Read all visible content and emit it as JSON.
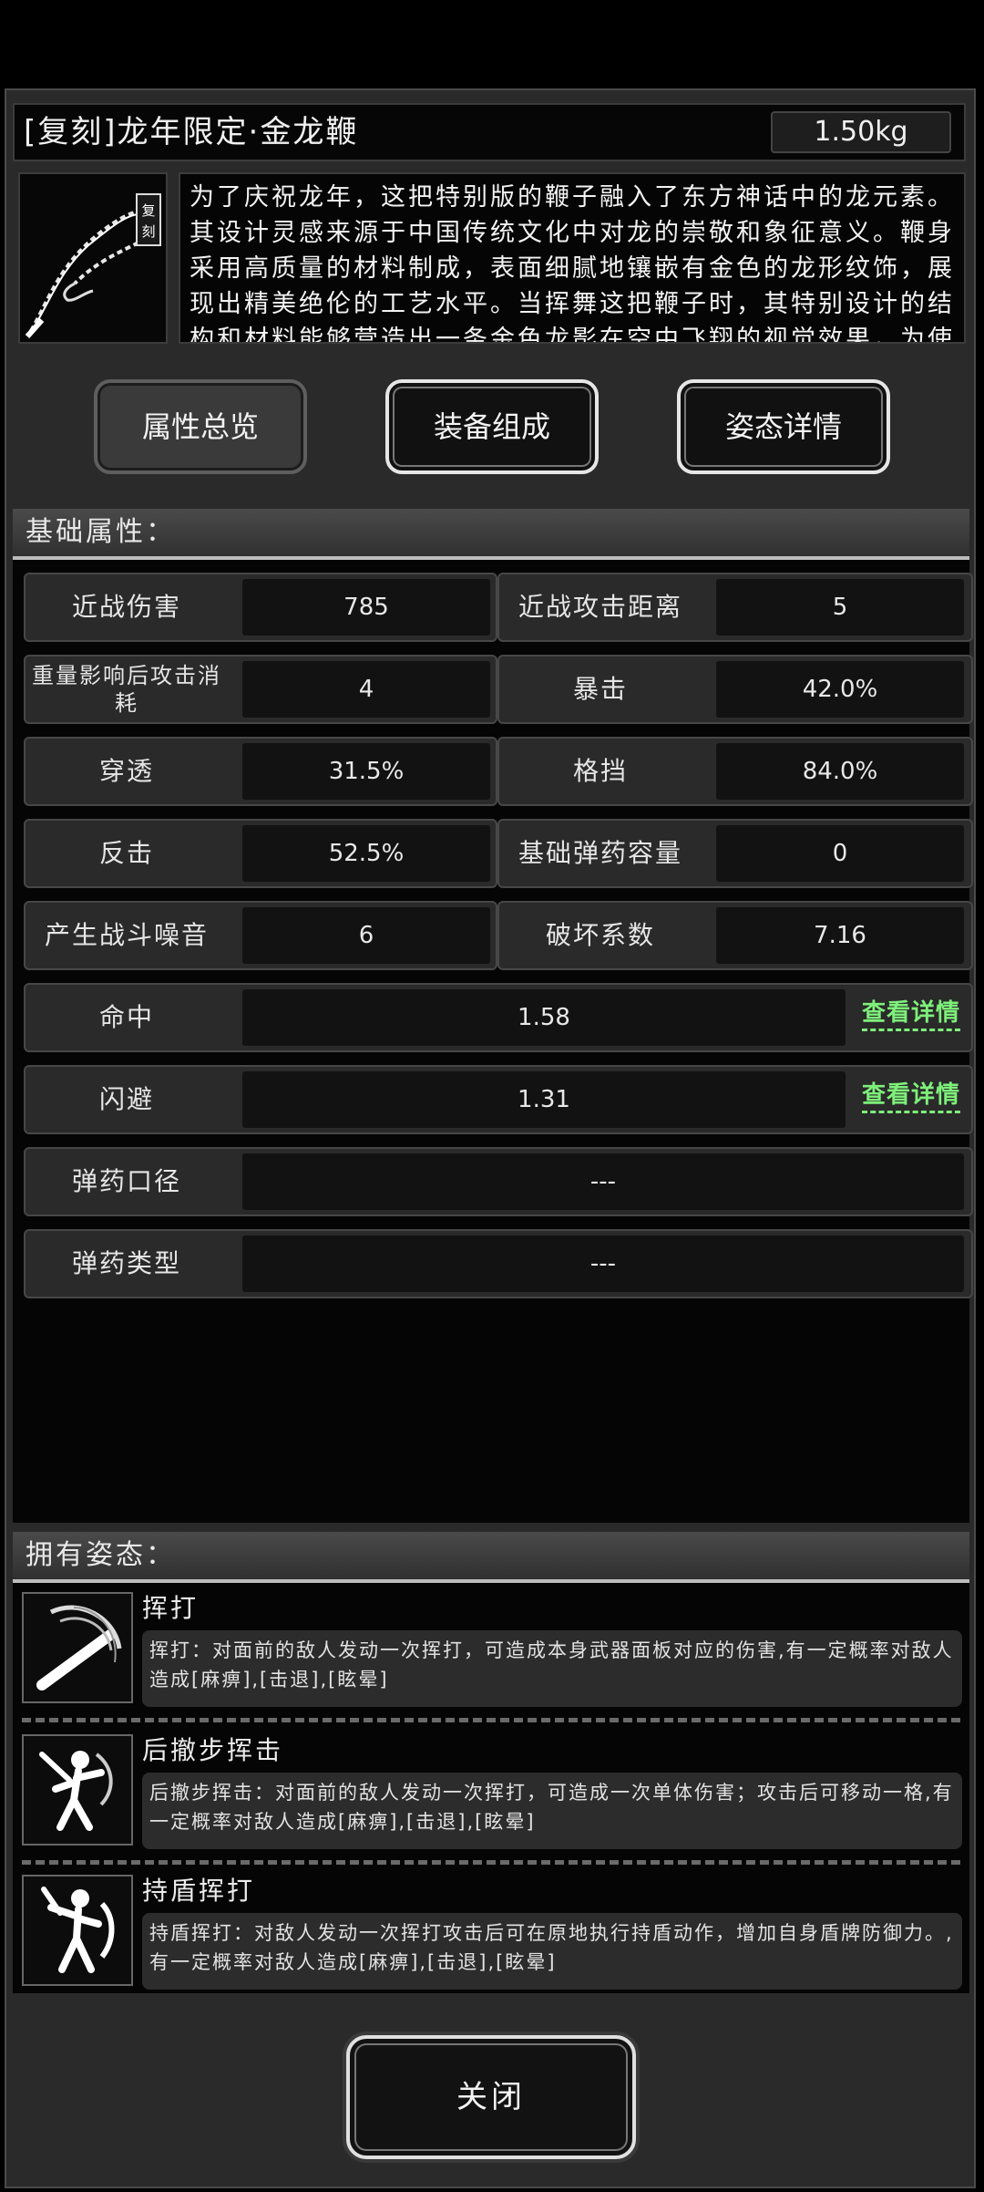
{
  "item": {
    "title": "[复刻]龙年限定·金龙鞭",
    "weight": "1.50kg",
    "image_badge": "复刻",
    "description": "为了庆祝龙年，这把特别版的鞭子融入了东方神话中的龙元素。其设计灵感来源于中国传统文化中对龙的崇敬和象征意义。鞭身采用高质量的材料制成，表面细腻地镶嵌有金色的龙形纹饰，展现出精美绝伦的工艺水平。当挥舞这把鞭子时，其特别设计的结构和材料能够营造出一条金色龙影在空中飞翔的视觉效果，为使"
  },
  "tabs": [
    {
      "label": "属性总览",
      "active": false
    },
    {
      "label": "装备组成",
      "active": true
    },
    {
      "label": "姿态详情",
      "active": true
    }
  ],
  "basic_attrs": {
    "header": "基础属性：",
    "pairs": [
      {
        "label": "近战伤害",
        "value": "785"
      },
      {
        "label": "近战攻击距离",
        "value": "5"
      },
      {
        "label": "重量影响后攻击消耗",
        "value": "4"
      },
      {
        "label": "暴击",
        "value": "42.0%"
      },
      {
        "label": "穿透",
        "value": "31.5%"
      },
      {
        "label": "格挡",
        "value": "84.0%"
      },
      {
        "label": "反击",
        "value": "52.5%"
      },
      {
        "label": "基础弹药容量",
        "value": "0"
      },
      {
        "label": "产生战斗噪音",
        "value": "6"
      },
      {
        "label": "破坏系数",
        "value": "7.16"
      }
    ],
    "wide": [
      {
        "label": "命中",
        "value": "1.58",
        "link": "查看详情"
      },
      {
        "label": "闪避",
        "value": "1.31",
        "link": "查看详情"
      },
      {
        "label": "弹药口径",
        "value": "---"
      },
      {
        "label": "弹药类型",
        "value": "---"
      }
    ]
  },
  "stances": {
    "header": "拥有姿态：",
    "items": [
      {
        "name": "挥打",
        "icon": "swing-strike-icon",
        "desc": "挥打：对面前的敌人发动一次挥打，可造成本身武器面板对应的伤害,有一定概率对敌人造成[麻痹],[击退],[眩晕]"
      },
      {
        "name": "后撤步挥击",
        "icon": "backstep-strike-icon",
        "desc": "后撤步挥击：对面前的敌人发动一次挥打，可造成一次单体伤害；攻击后可移动一格,有一定概率对敌人造成[麻痹],[击退],[眩晕]"
      },
      {
        "name": "持盾挥打",
        "icon": "shield-strike-icon",
        "desc": "持盾挥打：对敌人发动一次挥打攻击后可在原地执行持盾动作，增加自身盾牌防御力。,有一定概率对敌人造成[麻痹],[击退],[眩晕]"
      }
    ]
  },
  "footer": {
    "close_label": "关闭"
  }
}
